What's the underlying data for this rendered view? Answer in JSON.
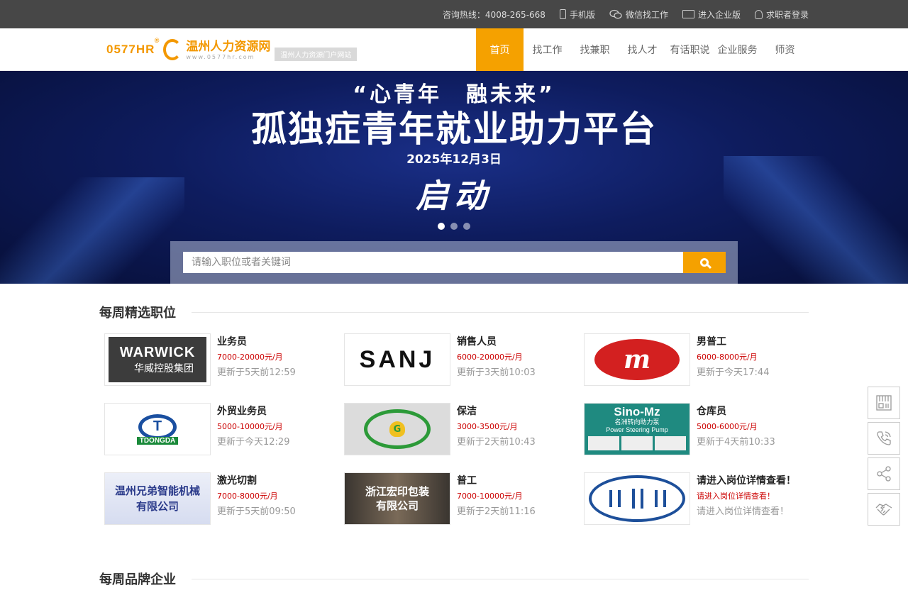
{
  "topbar": {
    "hotline": "咨询热线：4008-265-668",
    "mobile": "手机版",
    "wechat": "微信找工作",
    "enterprise": "进入企业版",
    "login": "求职者登录"
  },
  "logo": {
    "hr": "0577HR",
    "reg": "®",
    "name": "温州人力资源网",
    "url": "www.0577hr.com",
    "slogan": "温州人力资源门户网站"
  },
  "nav": [
    {
      "label": "首页",
      "active": true
    },
    {
      "label": "找工作"
    },
    {
      "label": "找兼职"
    },
    {
      "label": "找人才"
    },
    {
      "label": "有话职说"
    },
    {
      "label": "企业服务"
    },
    {
      "label": "师资"
    }
  ],
  "banner": {
    "quote": "“心青年　融未来”",
    "title": "孤独症青年就业助力平台",
    "date": "2025年12月3日",
    "launch": "启动"
  },
  "search": {
    "placeholder": "请输入职位或者关键词"
  },
  "sections": {
    "weekly_jobs": "每周精选职位",
    "weekly_brands": "每周品牌企业"
  },
  "logos": {
    "warwick_en": "WARWICK",
    "warwick_cn": "华威控股集团",
    "sanj": "SANJ",
    "m": "m",
    "dongda_mark": "T",
    "dongda_text": "TDONGDA",
    "g": "G",
    "sino": "Sino-Mz",
    "sino_cn": "名洲转向助力泵",
    "sino_en": "Power Steering Pump",
    "xiongdi_1": "温州兄弟智能机械",
    "xiongdi_2": "有限公司",
    "hongyin_1": "浙江宏印包装",
    "hongyin_2": "有限公司"
  },
  "jobs": [
    {
      "title": "业务员",
      "salary": "7000-20000元/月",
      "updated": "更新于5天前12:59"
    },
    {
      "title": "销售人员",
      "salary": "6000-20000元/月",
      "updated": "更新于3天前10:03"
    },
    {
      "title": "男普工",
      "salary": "6000-8000元/月",
      "updated": "更新于今天17:44"
    },
    {
      "title": "外贸业务员",
      "salary": "5000-10000元/月",
      "updated": "更新于今天12:29"
    },
    {
      "title": "保洁",
      "salary": "3000-3500元/月",
      "updated": "更新于2天前10:43"
    },
    {
      "title": "仓库员",
      "salary": "5000-6000元/月",
      "updated": "更新于4天前10:33"
    },
    {
      "title": "激光切割",
      "salary": "7000-8000元/月",
      "updated": "更新于5天前09:50"
    },
    {
      "title": "普工",
      "salary": "7000-10000元/月",
      "updated": "更新于2天前11:16"
    },
    {
      "title": "请进入岗位详情查看！",
      "salary": "请进入岗位详情查看！",
      "updated": "请进入岗位详情查看！"
    }
  ],
  "colors": {
    "accent": "#f5a100",
    "salary": "#cc0000",
    "topbar": "#474747"
  },
  "side_tools": [
    "qrcode-icon",
    "phone-icon",
    "share-icon",
    "handshake-icon"
  ]
}
